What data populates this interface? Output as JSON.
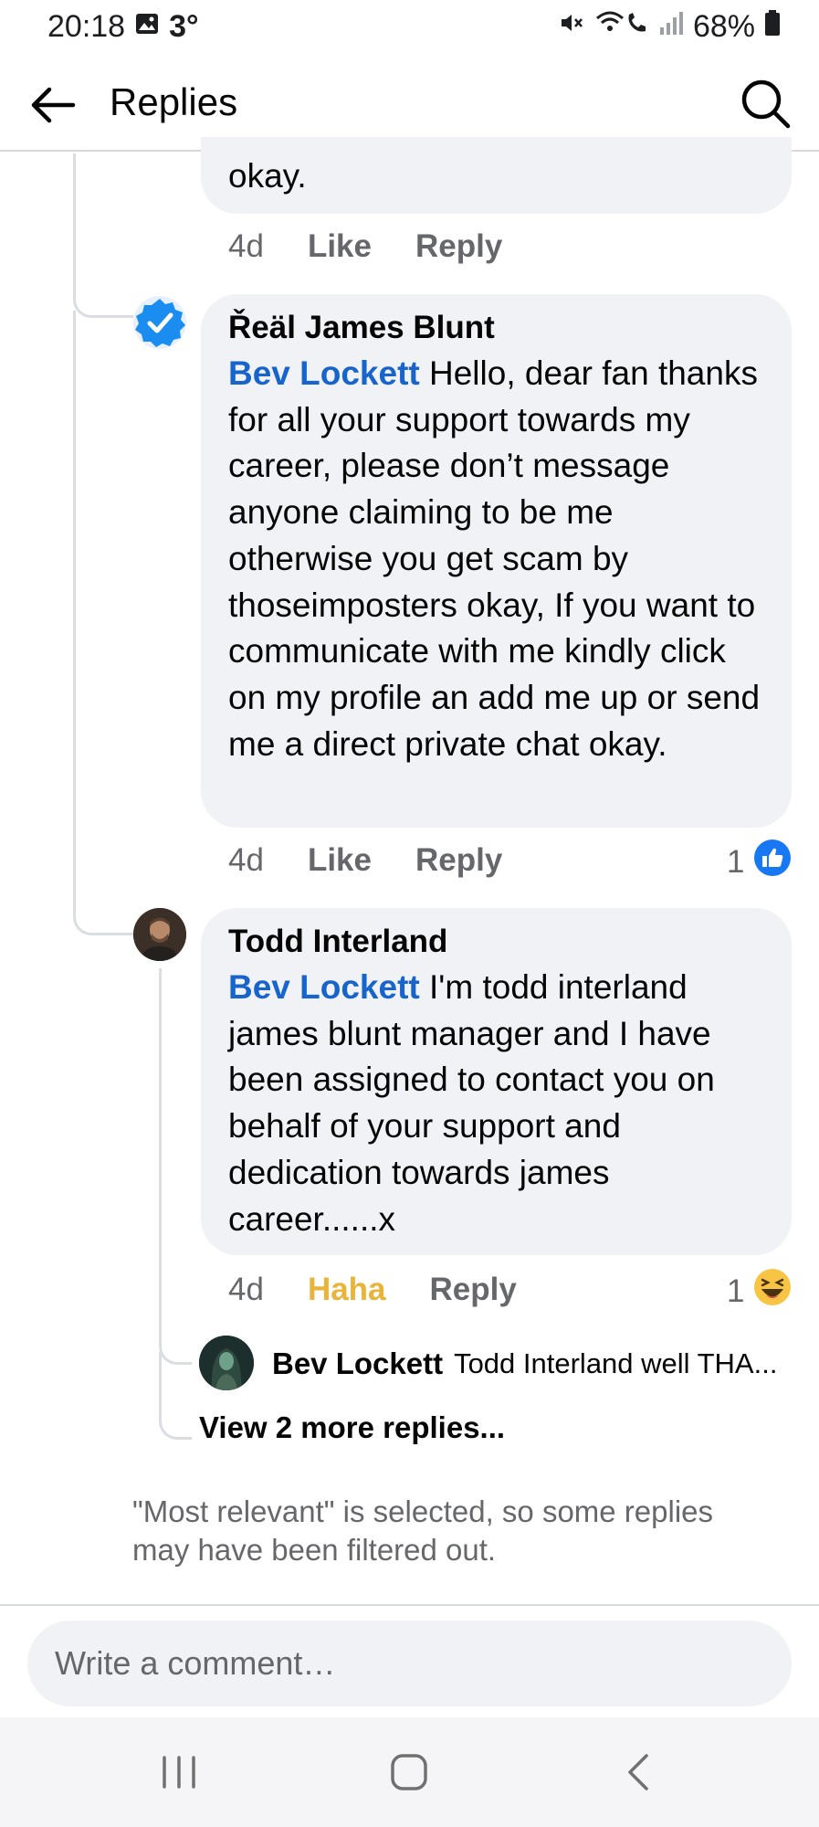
{
  "status_bar": {
    "time": "20:18",
    "temperature": "3°",
    "battery": "68%",
    "icons": [
      "gallery-icon",
      "mute-icon",
      "wifi-call-icon",
      "signal-icon",
      "battery-icon"
    ]
  },
  "app_bar": {
    "title": "Replies",
    "back_icon": "arrow-left-icon",
    "search_icon": "search-icon"
  },
  "comments": [
    {
      "text": "okay.",
      "time": "4d",
      "like_label": "Like",
      "reply_label": "Reply"
    },
    {
      "author": "Řeäl James Blunt",
      "mention": "Bev Lockett",
      "text": " Hello, dear fan thanks for all your support towards my career, please don’t message anyone claiming to be me otherwise you get scam by thoseimposters okay, If you want to communicate with me kindly click on my profile an add me up or send me a direct private chat okay.",
      "time": "4d",
      "like_label": "Like",
      "reply_label": "Reply",
      "reaction_count": "1",
      "reaction": "like-reaction-icon",
      "avatar_icon": "verified-badge-icon"
    },
    {
      "author": "Todd Interland",
      "mention": "Bev Lockett",
      "text": " I'm todd interland james blunt manager and I have been assigned to contact you on behalf of your support and dedication towards james career......x",
      "time": "4d",
      "reaction_label": "Haha",
      "reply_label": "Reply",
      "reaction_count": "1",
      "reaction": "haha-reaction-icon"
    }
  ],
  "reply_preview": {
    "author": "Bev Lockett",
    "text": "Todd Interland well THA..."
  },
  "view_more": "View 2 more replies...",
  "filter_note": "\"Most relevant\" is selected, so some replies may have been filtered out.",
  "composer": {
    "placeholder": "Write a comment…"
  },
  "colors": {
    "mention": "#1664cc",
    "haha": "#e9b43a",
    "bubble": "#f0f2f5",
    "like_blue": "#1877f2"
  }
}
